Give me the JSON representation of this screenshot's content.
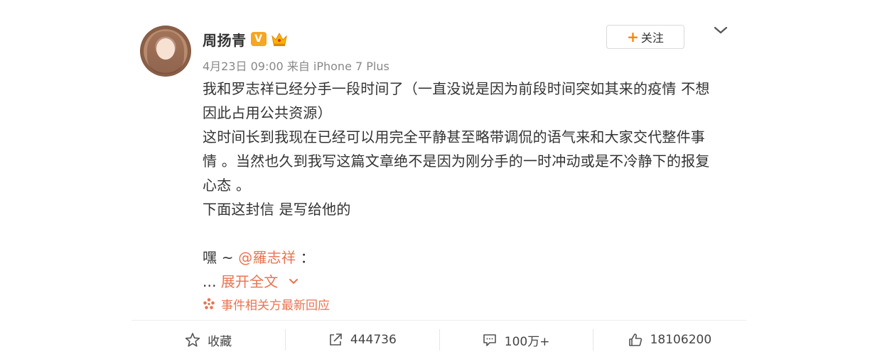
{
  "user": {
    "name": "周扬青",
    "verified_badge": "V",
    "accent_color": "#f5a623"
  },
  "meta": {
    "text": "4月23日 09:00 来自 iPhone 7 Plus"
  },
  "follow": {
    "plus": "+",
    "label": "关注"
  },
  "post": {
    "lines": [
      "我和罗志祥已经分手一段时间了（一直没说是因为前段时间突如其来的疫情 不想",
      "因此占用公共资源）",
      "这时间长到我现在已经可以用完全平静甚至略带调侃的语气来和大家交代整件事",
      "情 。当然也久到我写这篇文章绝不是因为刚分手的一时冲动或是不冷静下的报复",
      "心态 。",
      "下面这封信 是写给他的"
    ],
    "greeting_prefix": "嘿 ~ ",
    "mention": "@羅志祥",
    "greeting_suffix": " ：",
    "ellipsis": "... ",
    "expand_label": "展开全文",
    "mention_color": "#eb7350"
  },
  "event": {
    "label": "事件相关方最新回应",
    "icon": "sparkle-icon"
  },
  "actions": {
    "favorite_label": "收藏",
    "share_count": "444736",
    "comment_count": "100万+",
    "like_count": "18106200"
  }
}
